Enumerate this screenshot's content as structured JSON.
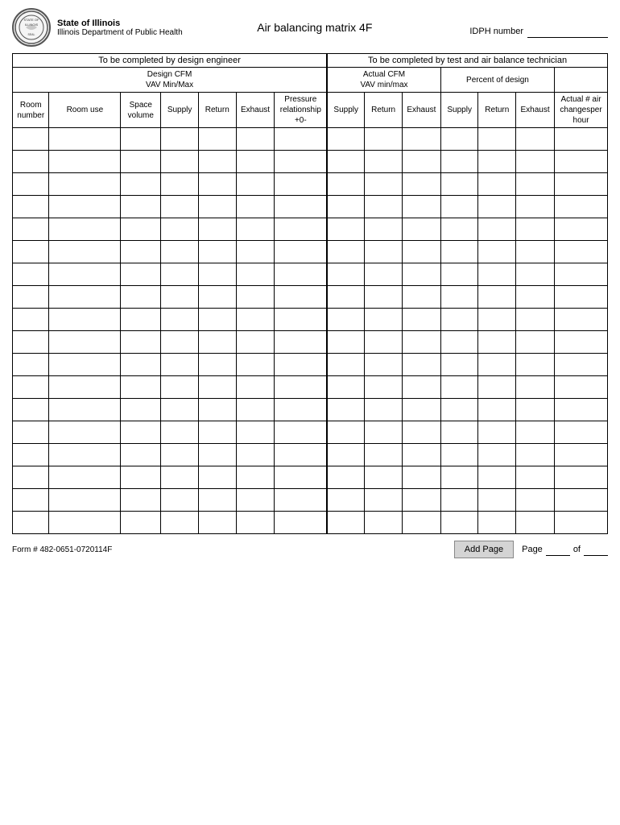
{
  "header": {
    "state": "State of Illinois",
    "dept": "Illinois Department of Public Health",
    "title": "Air balancing matrix  4F",
    "idph_label": "IDPH number"
  },
  "sections": {
    "left_header": "To be completed by  design engineer",
    "right_header": "To be completed by test and air balance technician"
  },
  "design_cfm": {
    "label": "Design CFM",
    "sublabel": "VAV Min/Max"
  },
  "actual_cfm": {
    "label": "Actual CFM",
    "sublabel": "VAV min/max"
  },
  "percent_of_design": {
    "label": "Percent of design"
  },
  "columns": [
    {
      "key": "room_number",
      "label": "Room\nnumber"
    },
    {
      "key": "room_use",
      "label": "Room use"
    },
    {
      "key": "space_volume",
      "label": "Space\nvolume"
    },
    {
      "key": "supply_design",
      "label": "Supply"
    },
    {
      "key": "return_design",
      "label": "Return"
    },
    {
      "key": "exhaust_design",
      "label": "Exhaust"
    },
    {
      "key": "pressure_rel",
      "label": "Pressure\nrelationship\n+0-"
    },
    {
      "key": "supply_actual",
      "label": "Supply"
    },
    {
      "key": "return_actual",
      "label": "Return"
    },
    {
      "key": "exhaust_actual",
      "label": "Exhaust"
    },
    {
      "key": "supply_pct",
      "label": "Supply"
    },
    {
      "key": "return_pct",
      "label": "Return"
    },
    {
      "key": "exhaust_pct",
      "label": "Exhaust"
    },
    {
      "key": "actual_air_changes",
      "label": "Actual # air\nchangesper\nhour"
    }
  ],
  "data_rows": 18,
  "footer": {
    "form_number": "Form # 482-0651-0720114F",
    "add_page_label": "Add Page",
    "page_label": "Page",
    "of_label": "of"
  }
}
